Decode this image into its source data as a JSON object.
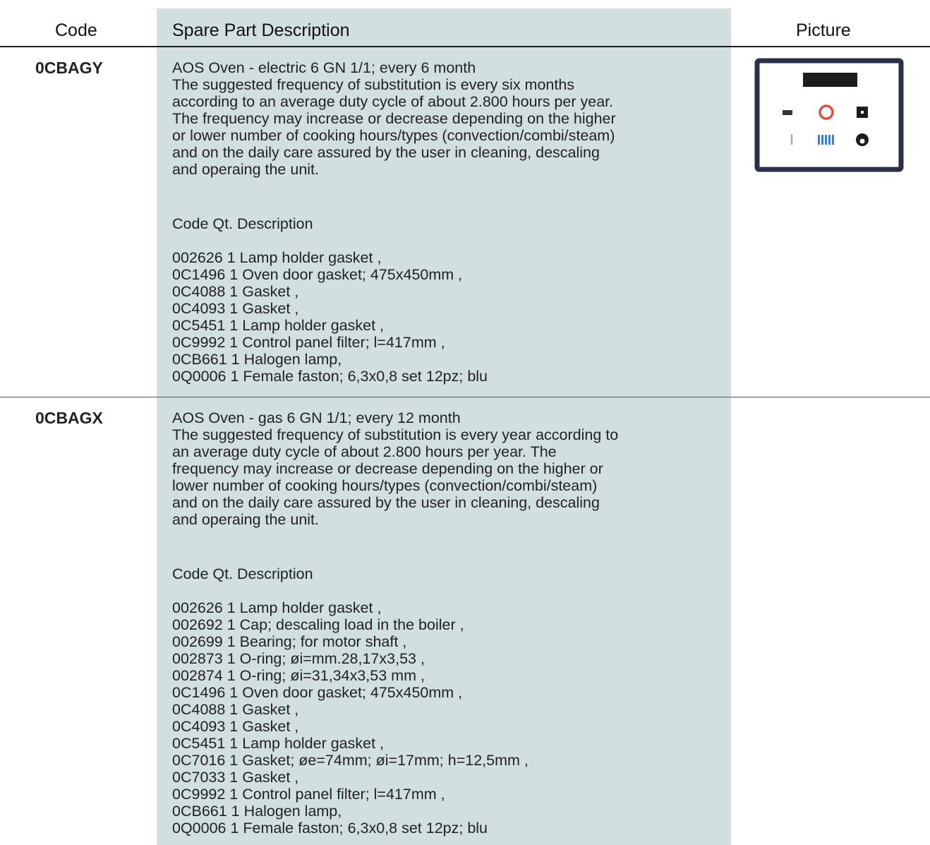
{
  "header": {
    "code": "Code",
    "description": "Spare Part Description",
    "picture": "Picture"
  },
  "rows": [
    {
      "code": "0CBAGY",
      "title": "AOS Oven - electric 6 GN 1/1; every 6 month",
      "text": [
        "The suggested frequency of substitution is every six months",
        "according to an average duty cycle of about 2.800 hours per year.",
        "The frequency may increase or decrease depending on the higher",
        "or lower number of cooking hours/types (convection/combi/steam)",
        "and on the daily care assured by the user in cleaning, descaling",
        "and operaing the unit."
      ],
      "list_header": "Code Qt. Description",
      "items": [
        "002626 1 Lamp holder gasket ,",
        "0C1496 1 Oven door gasket; 475x450mm ,",
        "0C4088 1 Gasket ,",
        "0C4093 1 Gasket ,",
        "0C5451 1 Lamp holder gasket ,",
        "0C9992 1 Control panel filter; l=417mm ,",
        "0CB661 1 Halogen lamp,",
        "0Q0006 1 Female faston; 6,3x0,8 set 12pz; blu"
      ]
    },
    {
      "code": "0CBAGX",
      "title": "AOS Oven - gas 6 GN 1/1; every 12 month",
      "text": [
        "The suggested frequency of substitution is every year according to",
        "an average duty cycle of about 2.800 hours per year. The",
        "frequency may increase or decrease depending on the higher or",
        "lower number of cooking hours/types (convection/combi/steam)",
        "and on the daily care assured by the user in cleaning, descaling",
        "and operaing the unit."
      ],
      "list_header": "Code Qt. Description",
      "items": [
        "002626 1 Lamp holder gasket ,",
        "002692 1 Cap; descaling load in the boiler ,",
        "002699 1 Bearing; for motor shaft ,",
        "002873 1 O-ring; øi=mm.28,17x3,53 ,",
        "002874 1 O-ring; øi=31,34x3,53 mm ,",
        "0C1496 1 Oven door gasket; 475x450mm ,",
        "0C4088 1 Gasket ,",
        "0C4093 1 Gasket ,",
        "0C5451 1 Lamp holder gasket ,",
        "0C7016 1 Gasket; øe=74mm; øi=17mm; h=12,5mm ,",
        "0C7033 1 Gasket ,",
        "0C9992 1 Control panel filter; l=417mm ,",
        "0CB661 1 Halogen lamp,",
        "0Q0006 1 Female faston; 6,3x0,8 set 12pz; blu"
      ]
    }
  ],
  "colors": {
    "description_band": "#d2dfdf",
    "rule": "#1e1e1e",
    "gasket": "#2a2f4a",
    "oring": "#e0503a",
    "blue_parts": "#3a7fd6"
  }
}
